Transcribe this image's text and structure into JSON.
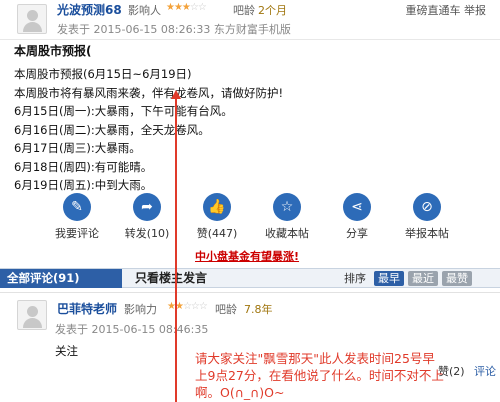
{
  "post": {
    "username": "光波预测68",
    "influence_label": "影响人",
    "stars_on": "★★★",
    "stars_off": "☆☆",
    "age_label": "吧龄",
    "age_value": "2个月",
    "top_link": "重磅直通车 举报",
    "time_line": "发表于 2015-06-15 08:26:33 东方财富手机版",
    "title": "本周股市预报(",
    "lines": [
      "本周股市预报(6月15日~6月19日)",
      "本周股市将有暴风雨来袭，伴有龙卷风，请做好防护!",
      "6月15日(周一):大暴雨，下午可能有台风。",
      "6月16日(周二):大暴雨，全天龙卷风。",
      "6月17日(周三):大暴雨。",
      "6月18日(周四):有可能晴。",
      "6月19日(周五):中到大雨。"
    ]
  },
  "actions": [
    {
      "label": "我要评论",
      "icon": "comment-icon"
    },
    {
      "label": "转发(10)",
      "icon": "share-arrow-icon"
    },
    {
      "label": "赞(447)",
      "icon": "thumbs-up-icon"
    },
    {
      "label": "收藏本帖",
      "icon": "bookmark-icon"
    },
    {
      "label": "分享",
      "icon": "share-nodes-icon"
    },
    {
      "label": "举报本帖",
      "icon": "report-icon"
    }
  ],
  "promo": "中小盘基金有望暴涨!",
  "tabs": {
    "all_comments": "全部评论(91)",
    "owner_only": "只看楼主发言",
    "sort_label": "排序",
    "sort_options": [
      "最早",
      "最近",
      "最赞"
    ]
  },
  "comment": {
    "username": "巴菲特老师",
    "influence_label": "影响力",
    "stars_on": "★★",
    "stars_off": "☆☆☆",
    "age_label": "吧龄",
    "age_value": "7.8年",
    "time_line": "发表于 2015-06-15 08:46:35",
    "text": "关注",
    "like_label": "赞(2)",
    "reply_label": "评论"
  },
  "annotation": {
    "text": "请大家关注\"飘雪那天\"此人发表时间25号早上9点27分，在看他说了什么。时间不对不上啊。O(∩_∩)O~"
  },
  "colors": {
    "accent": "#2d5fa6",
    "annotation_red": "#e03a2a",
    "promo_red": "#cc0000"
  }
}
